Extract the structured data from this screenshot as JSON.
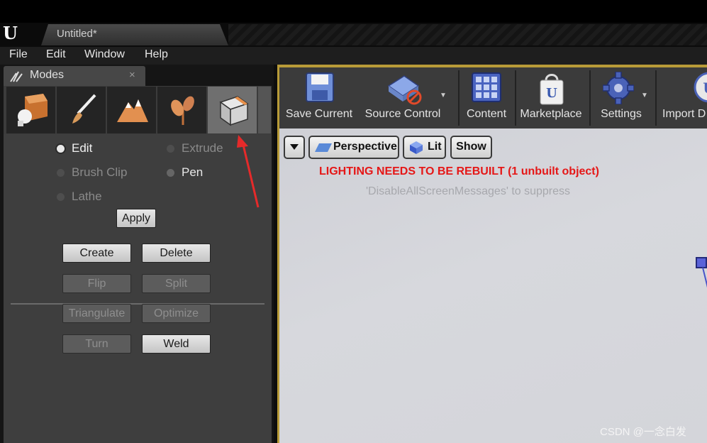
{
  "titlebar": {
    "tab_title": "Untitled*",
    "logo": "U"
  },
  "menu": [
    "File",
    "Edit",
    "Window",
    "Help"
  ],
  "modes": {
    "title": "Modes",
    "close": "×",
    "mode_icons": [
      "place-mode-icon",
      "paint-mode-icon",
      "landscape-mode-icon",
      "foliage-mode-icon",
      "geometry-edit-mode-icon"
    ],
    "radios": {
      "edit": "Edit",
      "extrude": "Extrude",
      "brush_clip": "Brush Clip",
      "pen": "Pen",
      "lathe": "Lathe"
    },
    "apply": "Apply",
    "buttons": {
      "create": "Create",
      "delete": "Delete",
      "flip": "Flip",
      "split": "Split",
      "triangulate": "Triangulate",
      "optimize": "Optimize",
      "turn": "Turn",
      "weld": "Weld"
    }
  },
  "toolbar": {
    "save_current": "Save Current",
    "source_control": "Source Control",
    "content": "Content",
    "marketplace": "Marketplace",
    "settings": "Settings",
    "import": "Import D"
  },
  "viewport": {
    "perspective": "Perspective",
    "lit": "Lit",
    "show": "Show",
    "warning": "LIGHTING NEEDS TO BE REBUILT (1 unbuilt object)",
    "suppress_hint": "'DisableAllScreenMessages' to suppress"
  },
  "watermark": "CSDN @一念白发",
  "colors": {
    "accent_gold": "#b89b38",
    "warning_red": "#e51717"
  }
}
